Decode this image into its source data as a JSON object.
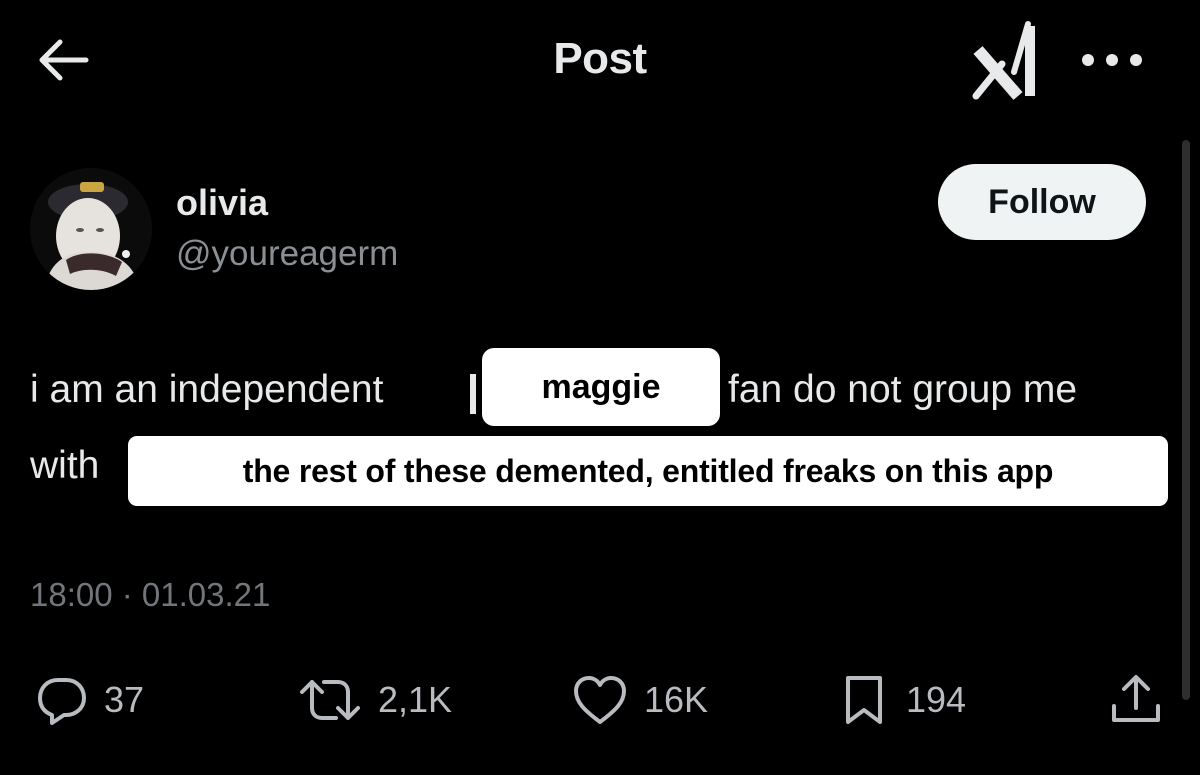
{
  "header": {
    "title": "Post"
  },
  "author": {
    "name": "olivia",
    "handle": "@youreagerm"
  },
  "follow_label": "Follow",
  "tweet": {
    "line1_start": "i am an independent",
    "line1_end": "fan do not group me",
    "line2_start": "with",
    "sticker_1": "maggie",
    "sticker_2": "the rest of these demented, entitled freaks on this app",
    "timestamp": "18:00 · 01.03.21"
  },
  "actions": {
    "replies": "37",
    "reposts": "2,1K",
    "likes": "16K",
    "bookmarks": "194"
  },
  "icons": [
    "back-arrow-icon",
    "x-logo-icon",
    "more-icon",
    "reply-icon",
    "repost-icon",
    "like-icon",
    "bookmark-icon",
    "share-icon"
  ],
  "colors": {
    "background": "#000000",
    "text": "#e7e9ea",
    "secondary_text": "#8b8f94",
    "follow_button_bg": "#eff3f4"
  }
}
